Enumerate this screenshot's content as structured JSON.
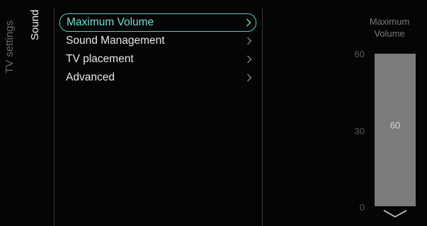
{
  "breadcrumb": {
    "root": "TV settings",
    "current": "Sound"
  },
  "menu": {
    "items": [
      {
        "label": "Maximum Volume",
        "selected": true
      },
      {
        "label": "Sound Management",
        "selected": false
      },
      {
        "label": "TV placement",
        "selected": false
      },
      {
        "label": "Advanced",
        "selected": false
      }
    ]
  },
  "panel": {
    "title": "Maximum Volume",
    "scale_max": "60",
    "scale_mid": "30",
    "scale_min": "0",
    "value": "60",
    "level_fraction": 1.0
  },
  "colors": {
    "accent": "#4fd1c5",
    "fill": "#7b7b7b"
  },
  "icons": {
    "item_arrow": "chevron-right-icon",
    "scroll_down": "chevron-down-icon"
  }
}
